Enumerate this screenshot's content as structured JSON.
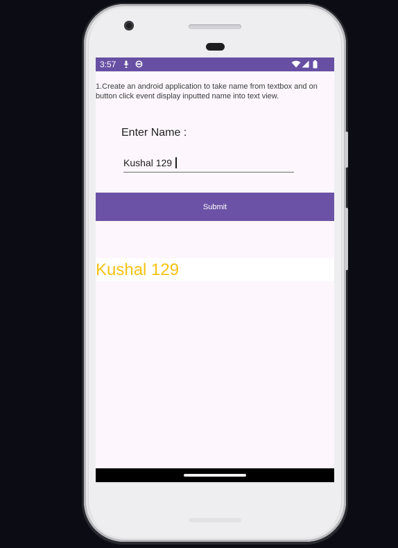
{
  "status_bar": {
    "time": "3:57",
    "left_icons": [
      "mic-icon",
      "data-saver-icon"
    ],
    "right_icons": [
      "wifi-icon",
      "signal-icon",
      "battery-icon"
    ],
    "color": "#6750a4"
  },
  "app": {
    "instruction": "1.Create an android application to take name from textbox and on button click event display inputted name into text view.",
    "name_label": "Enter Name :",
    "name_input_value": "Kushal 129",
    "submit_label": "Submit",
    "output_text": "Kushal 129",
    "accent_color": "#6b52a6",
    "output_color": "#f5c211"
  }
}
